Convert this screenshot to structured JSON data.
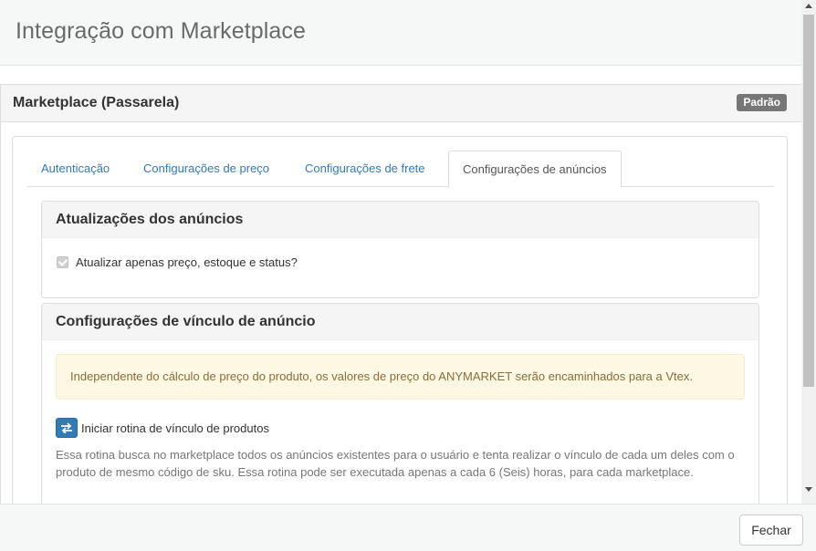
{
  "modal": {
    "title": "Integração com Marketplace"
  },
  "marketplace": {
    "title": "Marketplace (Passarela)",
    "badge": "Padrão"
  },
  "tabs": [
    {
      "label": "Autenticação",
      "active": false
    },
    {
      "label": "Configurações de preço",
      "active": false
    },
    {
      "label": "Configurações de frete",
      "active": false
    },
    {
      "label": "Configurações de anúncios",
      "active": true
    }
  ],
  "updates_panel": {
    "title": "Atualizações dos anúncios",
    "checkbox_label": "Atualizar apenas preço, estoque e status?",
    "checkbox_checked": true
  },
  "link_panel": {
    "title": "Configurações de vínculo de anúncio",
    "alert_text": "Independente do cálculo de preço do produto, os valores de preço do ANYMARKET serão encaminhados para a Vtex.",
    "routine_button_label": "Iniciar rotina de vínculo de produtos",
    "routine_description": "Essa rotina busca no marketplace todos os anúncios existentes para o usuário e tenta realizar o vínculo de cada um deles com o produto de mesmo código de sku. Essa rotina pode ser executada apenas a cada 6 (Seis) horas, para cada marketplace."
  },
  "footer": {
    "close_label": "Fechar"
  },
  "colors": {
    "link": "#337ab7",
    "badge": "#777777",
    "alert_bg": "#fcf8e3",
    "alert_text": "#8a6d3b"
  }
}
